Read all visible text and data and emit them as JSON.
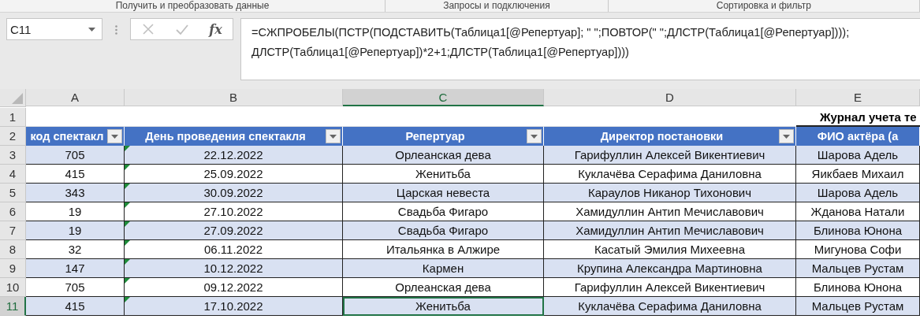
{
  "ribbon_groups": [
    "Получить и преобразовать данные",
    "Запросы и подключения",
    "Сортировка и фильтр"
  ],
  "name_box": "C11",
  "formula_buttons": [
    {
      "kind": "cancel",
      "disabled": true
    },
    {
      "kind": "enter",
      "disabled": true
    },
    {
      "kind": "function",
      "disabled": false,
      "label": "fx"
    }
  ],
  "formula_lines": [
    "=СЖПРОБЕЛЫ(ПСТР(ПОДСТАВИТЬ(Таблица1[@Репертуар]; \" \";ПОВТОР(\" \";ДЛСТР(Таблица1[@Репертуар])));",
    "ДЛСТР(Таблица1[@Репертуар])*2+1;ДЛСТР(Таблица1[@Репертуар])))"
  ],
  "columns": [
    {
      "letter": "A",
      "selected": false
    },
    {
      "letter": "B",
      "selected": false
    },
    {
      "letter": "C",
      "selected": true
    },
    {
      "letter": "D",
      "selected": false
    },
    {
      "letter": "E",
      "selected": false
    }
  ],
  "title_row": {
    "number": "1",
    "title": "Журнал учета те"
  },
  "header_row": {
    "number": "2",
    "headers": [
      {
        "label": "код спектакл",
        "filter": true
      },
      {
        "label": "День проведения спектакля",
        "filter": true
      },
      {
        "label": "Репертуар",
        "filter": true
      },
      {
        "label": "Директор постановки",
        "filter": true
      },
      {
        "label": "ФИО актёра (а",
        "filter": false
      }
    ]
  },
  "rows": [
    {
      "number": "3",
      "selected": false,
      "cells": [
        "705",
        "22.12.2022",
        "Орлеанская дева",
        "Гарифуллин Алексей Викентиевич",
        "Шарова Адель"
      ]
    },
    {
      "number": "4",
      "selected": false,
      "cells": [
        "415",
        "25.09.2022",
        "Женитьба",
        "Куклачёва Серафима Даниловна",
        "Яикбаев Михаил"
      ]
    },
    {
      "number": "5",
      "selected": false,
      "cells": [
        "343",
        "30.09.2022",
        "Царская невеста",
        "Караулов Никанор Тихонович",
        "Шарова Адель"
      ]
    },
    {
      "number": "6",
      "selected": false,
      "cells": [
        "19",
        "27.10.2022",
        "Свадьба Фигаро",
        "Хамидуллин Антип Мечиславович",
        "Жданова Натали"
      ]
    },
    {
      "number": "7",
      "selected": false,
      "cells": [
        "19",
        "27.09.2022",
        "Свадьба Фигаро",
        "Хамидуллин Антип Мечиславович",
        "Блинова Юнона"
      ]
    },
    {
      "number": "8",
      "selected": false,
      "cells": [
        "32",
        "06.11.2022",
        "Итальянка в Алжире",
        "Касатый Эмилия Михеевна",
        "Мигунова Софи"
      ]
    },
    {
      "number": "9",
      "selected": false,
      "cells": [
        "147",
        "10.12.2022",
        "Кармен",
        "Крупина Александра Мартиновна",
        "Мальцев Рустам"
      ]
    },
    {
      "number": "10",
      "selected": false,
      "cells": [
        "705",
        "09.12.2022",
        "Орлеанская дева",
        "Гарифуллин Алексей Викентиевич",
        "Блинова Юнона"
      ]
    },
    {
      "number": "11",
      "selected": true,
      "cells": [
        "415",
        "17.10.2022",
        "Женитьба",
        "Куклачёва Серафима Даниловна",
        "Мальцев Рустам"
      ]
    }
  ]
}
